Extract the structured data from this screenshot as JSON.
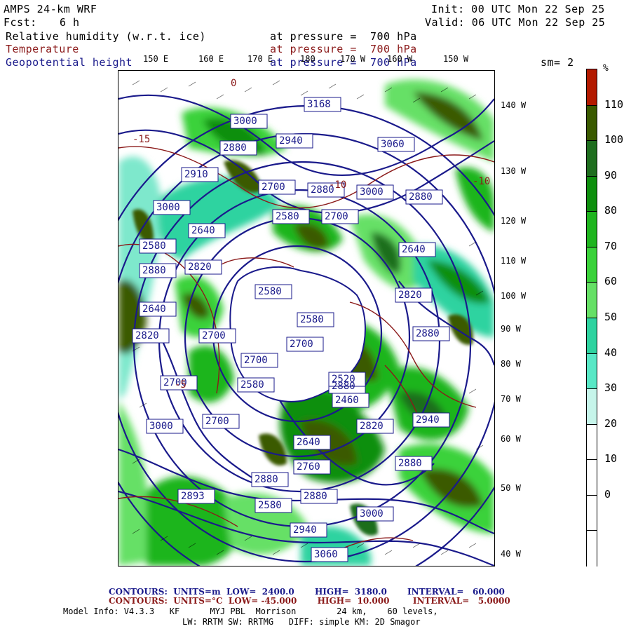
{
  "header": {
    "model": "AMPS 24-km WRF",
    "fcst_label": "Fcst:",
    "fcst_value": "6 h",
    "init": "Init: 00 UTC Mon 22 Sep 25",
    "valid": "Valid: 06 UTC Mon 22 Sep 25",
    "fields": [
      {
        "name": "Relative humidity (w.r.t. ice)",
        "level": "at pressure =  700 hPa",
        "color": "#000000"
      },
      {
        "name": "Temperature",
        "level": "at pressure =  700 hPa",
        "color": "#8b1a1a"
      },
      {
        "name": "Geopotential height",
        "level": "at pressure =  700 hPa",
        "color": "#1a1a8b"
      }
    ],
    "smoothing": "sm= 2"
  },
  "map": {
    "lon_labels": [
      "150 E",
      "160 E",
      "170 E",
      "180",
      "170 W",
      "160 W",
      "150 W"
    ],
    "lat_labels": [
      "140 W",
      "130 W",
      "120 W",
      "110 W",
      "100 W",
      "90 W",
      "80 W",
      "70 W",
      "60 W",
      "50 W",
      "40 W"
    ],
    "height_labels": [
      "3168",
      "3000",
      "2880",
      "2940",
      "3060",
      "2910",
      "3000",
      "2700",
      "2880",
      "3000",
      "2880",
      "2640",
      "2580",
      "2700",
      "2640",
      "2580",
      "2880",
      "2820",
      "2580",
      "2700",
      "2700",
      "2820",
      "2640",
      "2820",
      "2700",
      "2880",
      "2580",
      "2880",
      "2820",
      "2940",
      "2880",
      "2700",
      "2893",
      "2880",
      "3000",
      "2940",
      "3060",
      "2580",
      "2760",
      "2880",
      "3000",
      "2580",
      "2700",
      "2640",
      "2460",
      "2520"
    ],
    "temp_labels": [
      "-10",
      "-5",
      "0",
      "-15",
      "-10"
    ]
  },
  "colorbar": {
    "unit": "%",
    "labels": [
      "110",
      "100",
      "90",
      "80",
      "70",
      "60",
      "50",
      "40",
      "30",
      "20",
      "10",
      "0"
    ],
    "colors": [
      "#b31a00",
      "#3a5a00",
      "#1f6e1f",
      "#0e8f0e",
      "#1fb51f",
      "#3ad23a",
      "#66e066",
      "#2ed3a0",
      "#58e8c6",
      "#c6f5ea",
      "#ffffff",
      "#ffffff",
      "#ffffff",
      "#ffffff"
    ]
  },
  "footer": {
    "height_contours": "CONTOURS:  UNITS=m  LOW=  2400.0       HIGH=  3180.0       INTERVAL=   60.000",
    "temp_contours": "CONTOURS:  UNITS=°C  LOW= -45.000       HIGH=  10.000        INTERVAL=   5.0000",
    "model_info": "Model Info: V4.3.3   KF      MYJ PBL  Morrison        24 km,    60 levels,",
    "physics": "LW: RRTM SW: RRTMG   DIFF: simple KM: 2D Smagor"
  }
}
